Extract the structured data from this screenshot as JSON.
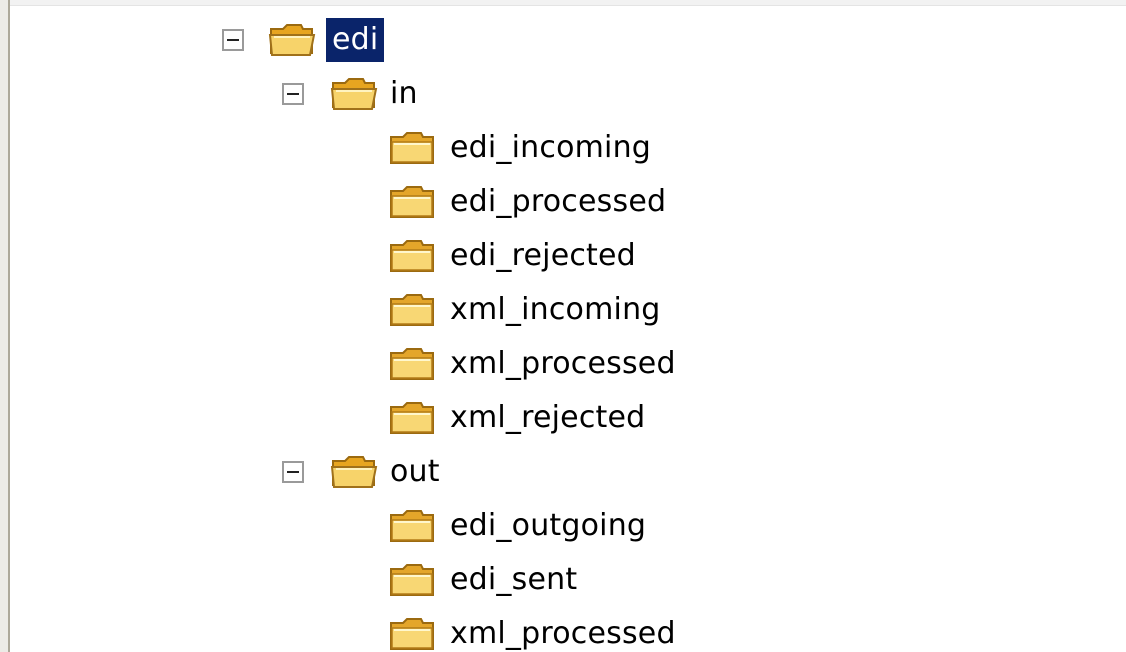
{
  "tree": {
    "root": {
      "label": "edi",
      "expanded": true,
      "selected": true,
      "icon": "folder-open-icon"
    },
    "in": {
      "label": "in",
      "expanded": true,
      "icon": "folder-open-icon",
      "children": [
        {
          "label": "edi_incoming",
          "icon": "folder-icon"
        },
        {
          "label": "edi_processed",
          "icon": "folder-icon"
        },
        {
          "label": "edi_rejected",
          "icon": "folder-icon"
        },
        {
          "label": "xml_incoming",
          "icon": "folder-icon"
        },
        {
          "label": "xml_processed",
          "icon": "folder-icon"
        },
        {
          "label": "xml_rejected",
          "icon": "folder-icon"
        }
      ]
    },
    "out": {
      "label": "out",
      "expanded": true,
      "icon": "folder-open-icon",
      "children": [
        {
          "label": "edi_outgoing",
          "icon": "folder-icon"
        },
        {
          "label": "edi_sent",
          "icon": "folder-icon"
        },
        {
          "label": "xml_processed",
          "icon": "folder-icon"
        }
      ]
    }
  },
  "colors": {
    "selection": "#0a246a",
    "folder": "#f5c242"
  }
}
